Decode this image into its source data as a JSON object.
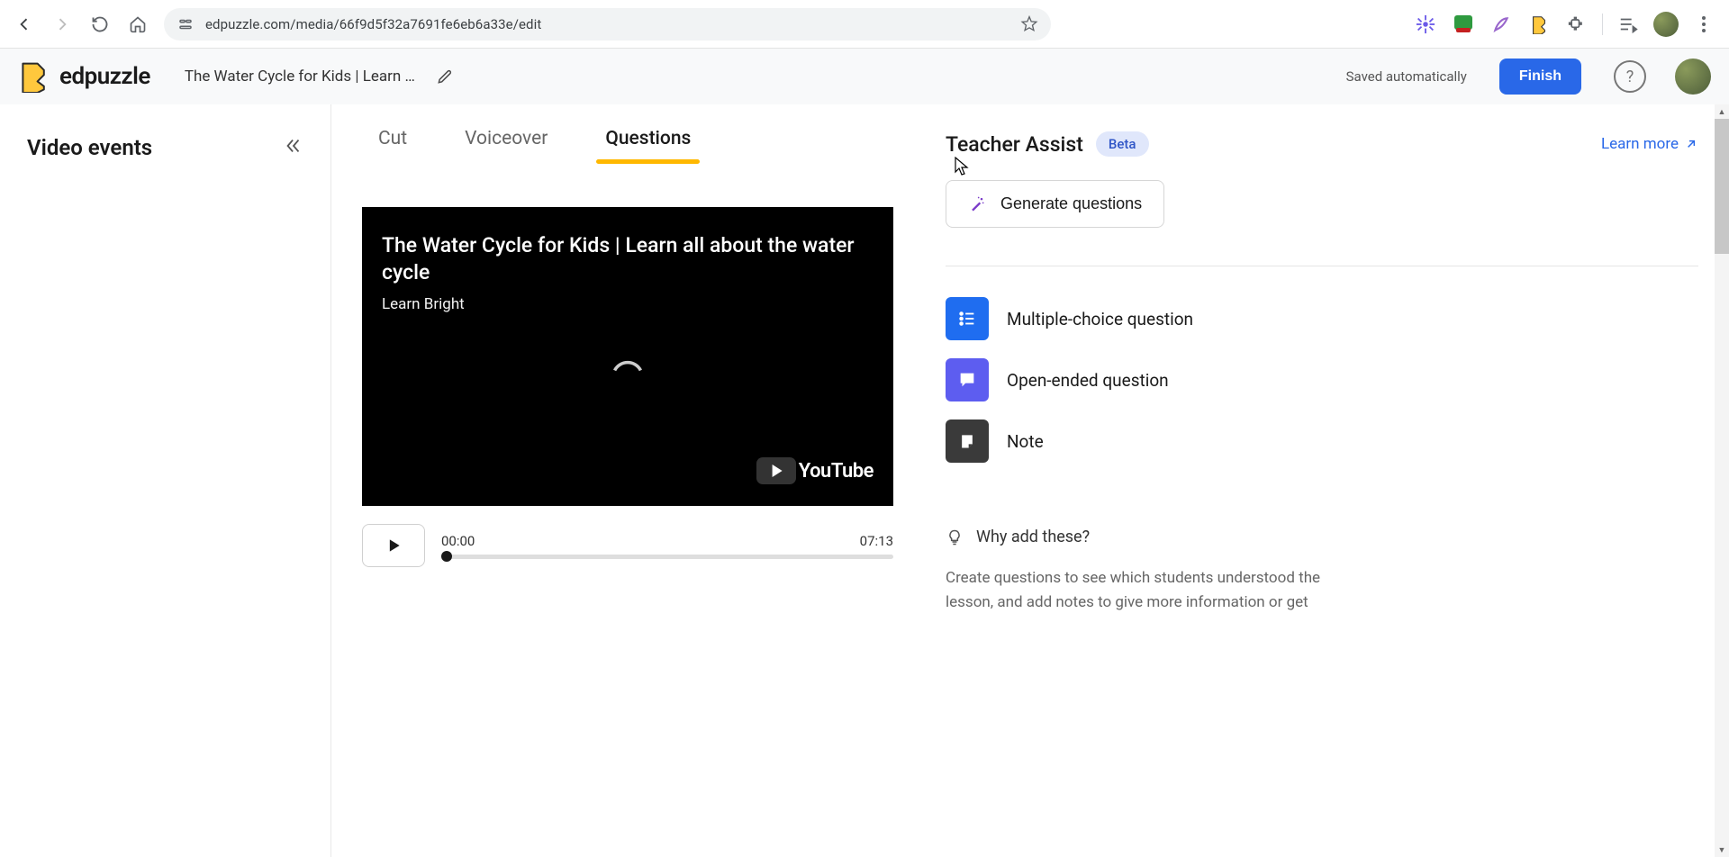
{
  "browser": {
    "url": "edpuzzle.com/media/66f9d5f32a7691fe6eb6a33e/edit"
  },
  "header": {
    "app_name": "edpuzzle",
    "doc_title": "The Water Cycle for Kids | Learn …",
    "save_status": "Saved automatically",
    "finish_label": "Finish"
  },
  "sidebar": {
    "title": "Video events"
  },
  "tabs": [
    {
      "label": "Cut",
      "active": false
    },
    {
      "label": "Voiceover",
      "active": false
    },
    {
      "label": "Questions",
      "active": true
    }
  ],
  "video": {
    "title": "The Water Cycle for Kids | Learn all about the water cycle",
    "author": "Learn Bright",
    "source_label": "YouTube",
    "current_time": "00:00",
    "duration": "07:13"
  },
  "teacher_assist": {
    "title": "Teacher Assist",
    "badge": "Beta",
    "learn_more": "Learn more",
    "generate_label": "Generate questions"
  },
  "question_types": [
    {
      "key": "multiple-choice",
      "label": "Multiple-choice question",
      "style": "mc",
      "icon": "list-icon"
    },
    {
      "key": "open-ended",
      "label": "Open-ended question",
      "style": "oe",
      "icon": "chat-icon"
    },
    {
      "key": "note",
      "label": "Note",
      "style": "note",
      "icon": "note-icon"
    }
  ],
  "hint": {
    "title": "Why add these?",
    "body": "Create questions to see which students understood the lesson, and add notes to give more information or get"
  }
}
